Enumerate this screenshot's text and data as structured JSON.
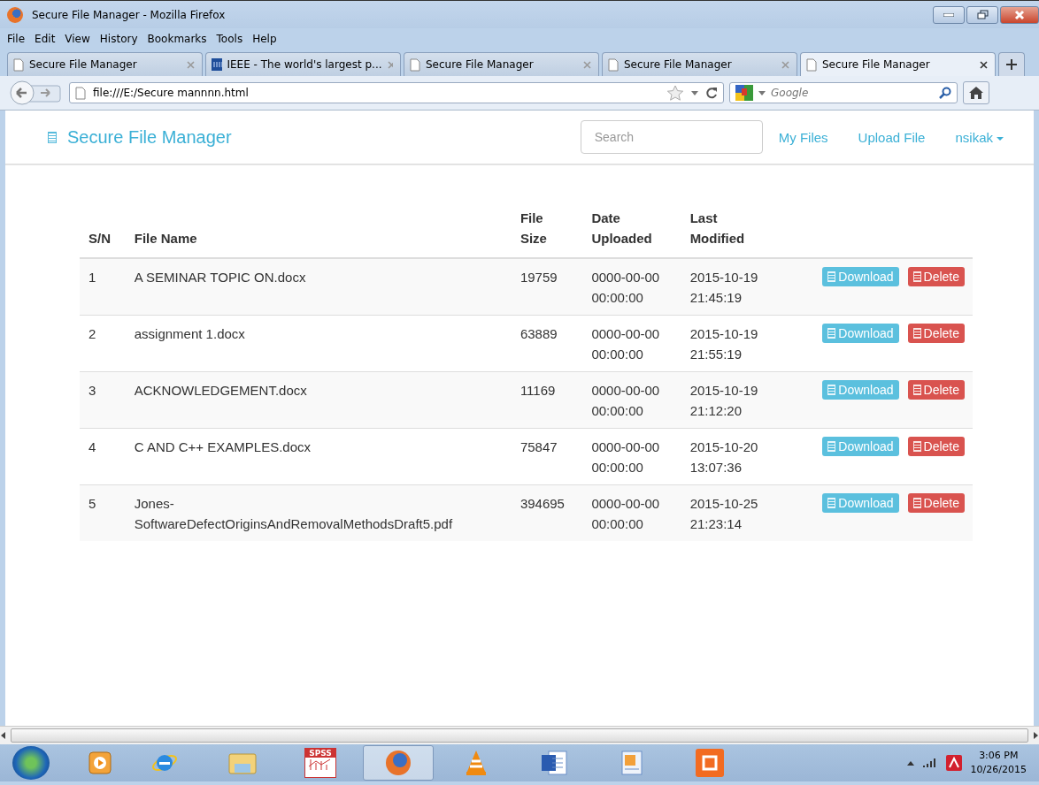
{
  "window": {
    "title": "Secure File Manager - Mozilla Firefox"
  },
  "menu": [
    "File",
    "Edit",
    "View",
    "History",
    "Bookmarks",
    "Tools",
    "Help"
  ],
  "tabs": [
    {
      "label": "Secure File Manager",
      "kind": "page",
      "selected": false
    },
    {
      "label": "IEEE - The world's largest p...",
      "kind": "ieee",
      "selected": false
    },
    {
      "label": "Secure File Manager",
      "kind": "page",
      "selected": false
    },
    {
      "label": "Secure File Manager",
      "kind": "page",
      "selected": false
    },
    {
      "label": "Secure File Manager",
      "kind": "page",
      "selected": true
    }
  ],
  "address": {
    "value": "file:///E:/Secure mannnn.html"
  },
  "web_search": {
    "placeholder": "Google"
  },
  "navbar": {
    "brand": "Secure File Manager",
    "search_placeholder": "Search",
    "links": [
      "My Files",
      "Upload File"
    ],
    "user": "nsikak"
  },
  "table": {
    "columns": [
      "S/N",
      "File Name",
      "File\nSize",
      "Date\nUploaded",
      "Last\nModified"
    ],
    "rows": [
      {
        "sn": "1",
        "name": "A SEMINAR TOPIC ON.docx",
        "size": "19759",
        "uploaded": "0000-00-00\n00:00:00",
        "modified": "2015-10-19\n21:45:19",
        "actions": [
          "Download",
          "Delete"
        ]
      },
      {
        "sn": "2",
        "name": "assignment 1.docx",
        "size": "63889",
        "uploaded": "0000-00-00\n00:00:00",
        "modified": "2015-10-19\n21:55:19",
        "actions": [
          "Download",
          "Delete"
        ]
      },
      {
        "sn": "3",
        "name": "ACKNOWLEDGEMENT.docx",
        "size": "11169",
        "uploaded": "0000-00-00\n00:00:00",
        "modified": "2015-10-19\n21:12:20",
        "actions": [
          "Download",
          "Delete"
        ]
      },
      {
        "sn": "4",
        "name": "C AND C++ EXAMPLES.docx",
        "size": "75847",
        "uploaded": "0000-00-00\n00:00:00",
        "modified": "2015-10-20\n13:07:36",
        "actions": [
          "Download",
          "Delete"
        ]
      },
      {
        "sn": "5",
        "name": "Jones-\nSoftwareDefectOriginsAndRemovalMethodsDraft5.pdf",
        "size": "394695",
        "uploaded": "0000-00-00\n00:00:00",
        "modified": "2015-10-25\n21:23:14",
        "actions": [
          "Download",
          "Delete"
        ]
      }
    ]
  },
  "taskbar": {
    "apps": [
      {
        "kind": "media",
        "selected": false
      },
      {
        "kind": "ie",
        "selected": false
      },
      {
        "kind": "explorer",
        "selected": false
      },
      {
        "kind": "spss",
        "label": "SPSS",
        "selected": false
      },
      {
        "kind": "firefox",
        "selected": true
      },
      {
        "kind": "vlc",
        "selected": false
      },
      {
        "kind": "word",
        "selected": false
      },
      {
        "kind": "reader",
        "selected": false
      },
      {
        "kind": "xampp",
        "selected": false
      }
    ],
    "time": "3:06 PM",
    "date": "10/26/2015"
  }
}
